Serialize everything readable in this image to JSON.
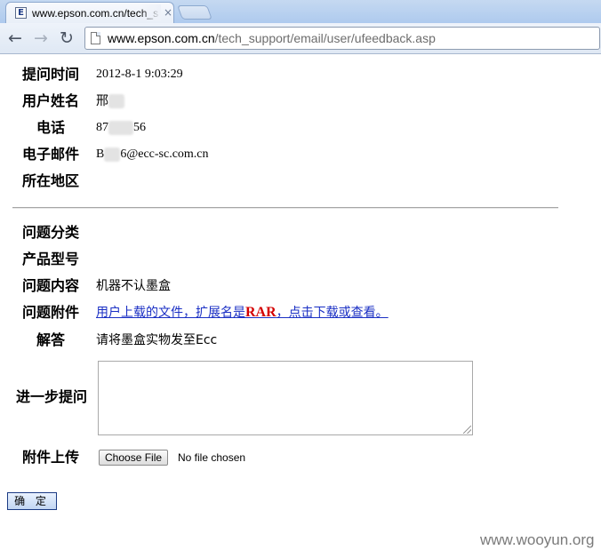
{
  "browser": {
    "tab": {
      "favicon_letter": "E",
      "title": "www.epson.com.cn/tech_s",
      "close_glyph": "×"
    },
    "nav": {
      "back_glyph": "←",
      "forward_glyph": "→",
      "reload_glyph": "↻"
    },
    "address": {
      "host": "www.epson.com.cn",
      "path": "/tech_support/email/user/ufeedback.asp"
    }
  },
  "form": {
    "submit_time": {
      "label": "提问时间",
      "value": "2012-8-1 9:03:29"
    },
    "user_name": {
      "label": "用户姓名",
      "value_visible": "邢"
    },
    "phone": {
      "label": "电话",
      "value_prefix": "87",
      "value_suffix": "56"
    },
    "email": {
      "label": "电子邮件",
      "value_prefix": "B",
      "value_suffix": "6@ecc-sc.com.cn"
    },
    "region": {
      "label": "所在地区",
      "value": ""
    },
    "category": {
      "label": "问题分类",
      "value": ""
    },
    "model": {
      "label": "产品型号",
      "value": ""
    },
    "content": {
      "label": "问题内容",
      "value": "机器不认墨盒"
    },
    "attachment": {
      "label": "问题附件",
      "link_prefix": "用户上载的文件，扩展名是",
      "link_ext": "RAR",
      "link_suffix": "，点击下载或查看。"
    },
    "answer": {
      "label": "解答",
      "value": "请将墨盒实物发至Ecc"
    },
    "followup": {
      "label": "进一步提问",
      "value": ""
    },
    "upload": {
      "label": "附件上传",
      "button_label": "Choose File",
      "status": "No file chosen"
    },
    "confirm_label": "确 定"
  },
  "watermark": "www.wooyun.org",
  "colors": {
    "link": "#1a2fc4",
    "ext_highlight": "#d40000",
    "button_border": "#1b3b84"
  }
}
